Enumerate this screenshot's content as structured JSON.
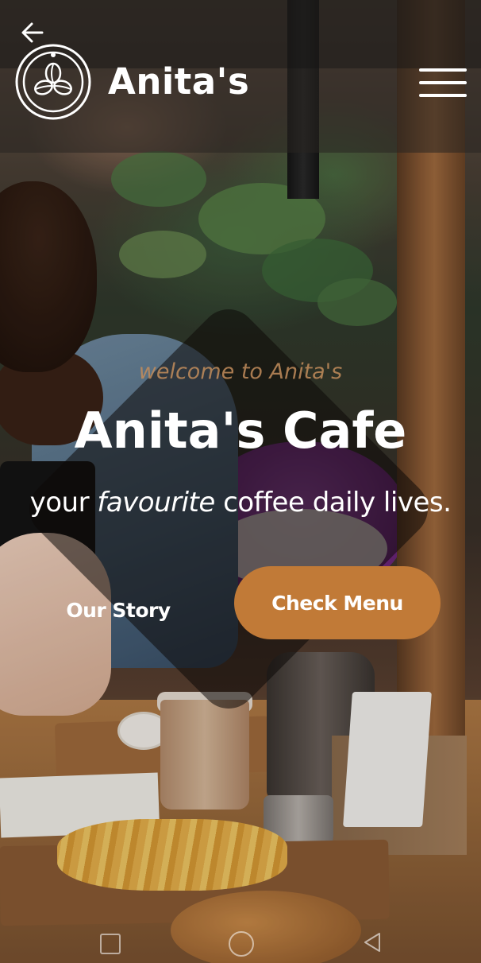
{
  "header": {
    "brand": "Anita's",
    "back_icon": "arrow-left-icon",
    "logo_icon": "coffee-beans-logo",
    "menu_icon": "hamburger-menu-icon"
  },
  "hero": {
    "welcome": "welcome to Anita's",
    "title": "Anita's Cafe",
    "tagline_start": "your ",
    "tagline_emphasis": "favourite",
    "tagline_end": " coffee daily lives.",
    "story_button": "Our Story",
    "menu_button": "Check Menu"
  },
  "system_nav": {
    "recents_icon": "square-recents-icon",
    "home_icon": "circle-home-icon",
    "back_icon": "triangle-back-icon"
  },
  "colors": {
    "accent": "#c17a37",
    "welcome_text": "#c38d5c",
    "text": "#ffffff"
  }
}
